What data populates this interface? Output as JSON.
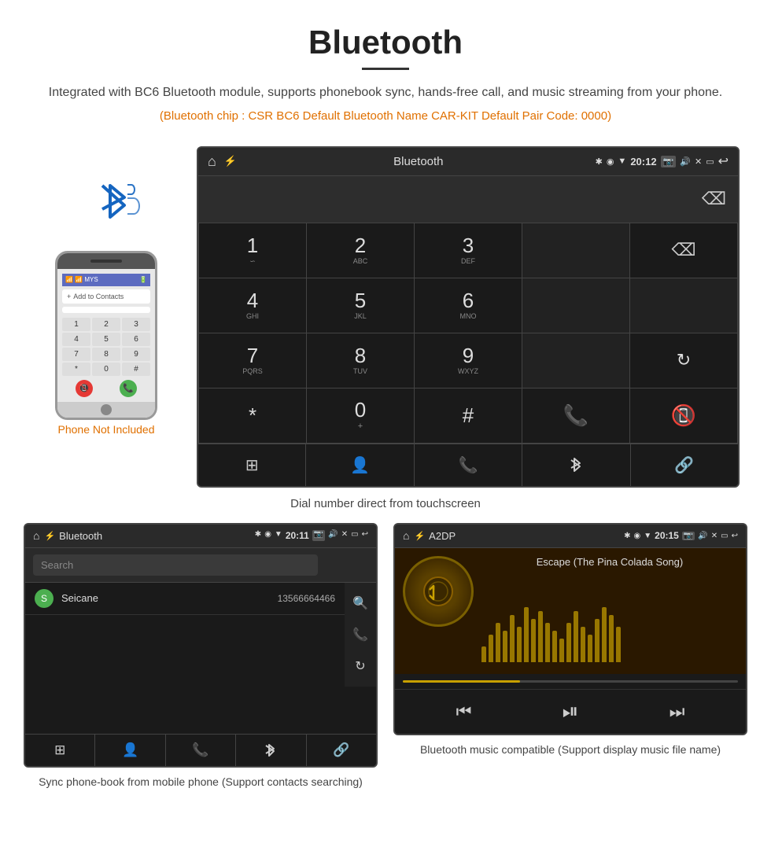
{
  "title": "Bluetooth",
  "title_underline": true,
  "description": "Integrated with BC6 Bluetooth module, supports phonebook sync, hands-free call, and music streaming from your phone.",
  "specs": "(Bluetooth chip : CSR BC6    Default Bluetooth Name CAR-KIT    Default Pair Code: 0000)",
  "phone_not_included": "Phone Not Included",
  "main_caption": "Dial number direct from touchscreen",
  "statusbar": {
    "home_icon": "⌂",
    "title": "Bluetooth",
    "usb_icon": "⚡",
    "bt_icon": "✱",
    "location_icon": "◉",
    "signal_icon": "▼",
    "time": "20:12",
    "camera_icon": "📷",
    "volume_icon": "🔊",
    "close_icon": "✕",
    "window_icon": "▭",
    "back_icon": "↩"
  },
  "dialpad": {
    "keys": [
      {
        "num": "1",
        "sub": "∽",
        "row": 0,
        "col": 0
      },
      {
        "num": "2",
        "sub": "ABC",
        "row": 0,
        "col": 1
      },
      {
        "num": "3",
        "sub": "DEF",
        "row": 0,
        "col": 2
      },
      {
        "num": "",
        "sub": "",
        "row": 0,
        "col": 3,
        "empty": true
      },
      {
        "num": "⌫",
        "sub": "",
        "row": 0,
        "col": 4,
        "backspace": true
      },
      {
        "num": "4",
        "sub": "GHI",
        "row": 1,
        "col": 0
      },
      {
        "num": "5",
        "sub": "JKL",
        "row": 1,
        "col": 1
      },
      {
        "num": "6",
        "sub": "MNO",
        "row": 1,
        "col": 2
      },
      {
        "num": "",
        "sub": "",
        "row": 1,
        "col": 3,
        "empty": true
      },
      {
        "num": "",
        "sub": "",
        "row": 1,
        "col": 4,
        "empty": true
      },
      {
        "num": "7",
        "sub": "PQRS",
        "row": 2,
        "col": 0
      },
      {
        "num": "8",
        "sub": "TUV",
        "row": 2,
        "col": 1
      },
      {
        "num": "9",
        "sub": "WXYZ",
        "row": 2,
        "col": 2
      },
      {
        "num": "",
        "sub": "",
        "row": 2,
        "col": 3,
        "empty": true
      },
      {
        "num": "⟳",
        "sub": "",
        "row": 2,
        "col": 4,
        "reload": true
      },
      {
        "num": "*",
        "sub": "",
        "row": 3,
        "col": 0
      },
      {
        "num": "0",
        "sub": "+",
        "row": 3,
        "col": 1
      },
      {
        "num": "#",
        "sub": "",
        "row": 3,
        "col": 2
      },
      {
        "num": "📞",
        "sub": "",
        "row": 3,
        "col": 3,
        "green": true
      },
      {
        "num": "📵",
        "sub": "",
        "row": 3,
        "col": 4,
        "red": true
      }
    ],
    "bottom_nav": [
      "⊞",
      "👤",
      "📞",
      "✱",
      "🔗"
    ]
  },
  "phonebook": {
    "status_title": "Bluetooth",
    "time": "20:11",
    "search_placeholder": "Search",
    "contacts": [
      {
        "letter": "S",
        "name": "Seicane",
        "number": "13566664466"
      }
    ],
    "side_icons": [
      "🔍",
      "📞",
      "⟳"
    ],
    "bottom_nav": [
      "⊞",
      "👤",
      "📞",
      "✱",
      "🔗"
    ]
  },
  "music": {
    "status_title": "A2DP",
    "time": "20:15",
    "song_title": "Escape (The Pina Colada Song)",
    "bt_symbol": "✱",
    "visualizer_bars": [
      20,
      35,
      50,
      40,
      60,
      45,
      70,
      55,
      65,
      50,
      40,
      30,
      50,
      65,
      45,
      35,
      55,
      70,
      60,
      45
    ],
    "controls": [
      "⏮",
      "⏯",
      "⏭"
    ]
  },
  "bottom_left_caption": "Sync phone-book from mobile phone\n(Support contacts searching)",
  "bottom_right_caption": "Bluetooth music compatible\n(Support display music file name)"
}
